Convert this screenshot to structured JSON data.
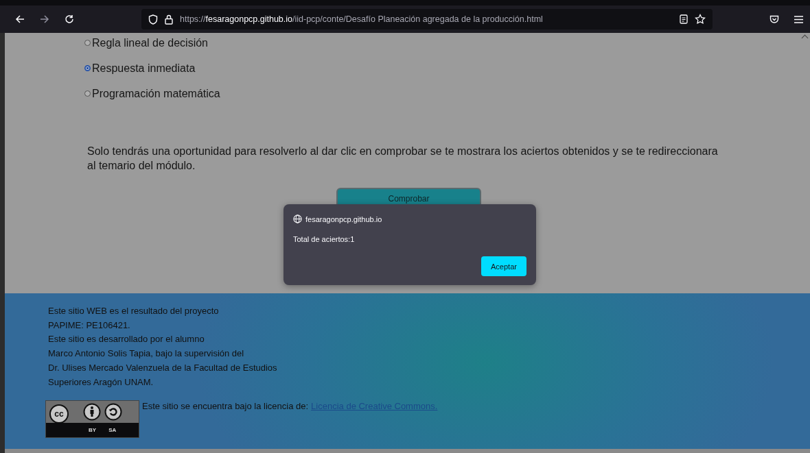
{
  "browser": {
    "url_prefix": "https://",
    "url_domain": "fesaragonpcp.github.io",
    "url_path": "/iid-pcp/conte/Desafío Planeación agregada de la producción.html"
  },
  "options": [
    {
      "label": "Regla lineal de decisión",
      "selected": false
    },
    {
      "label": "Respuesta inmediata",
      "selected": true
    },
    {
      "label": "Programación matemática",
      "selected": false
    }
  ],
  "instructions": "Solo tendrás una oportunidad para resolverlo al dar clic en comprobar se te mostrara los aciertos obtenidos y se te redireccionara al temario del módulo.",
  "check_button": "Comprobar",
  "dialog": {
    "origin": "fesaragonpcp.github.io",
    "message": "Total de aciertos:1",
    "button": "Aceptar"
  },
  "footer": {
    "lines": [
      "Este sitio WEB es el resultado del proyecto",
      "PAPIME: PE106421.",
      "Este sitio es desarrollado por el alumno",
      "Marco Antonio Solis Tapia, bajo la supervisión del",
      "Dr. Ulises Mercado Valenzuela de la Facultad de Estudios",
      "Superiores Aragón UNAM."
    ],
    "badge": {
      "logo": "cc",
      "labels": [
        "BY",
        "SA"
      ]
    },
    "license_text": "Este sitio se encuentra bajo la licencia de:",
    "license_link": "Licencia de Creative Commons."
  }
}
